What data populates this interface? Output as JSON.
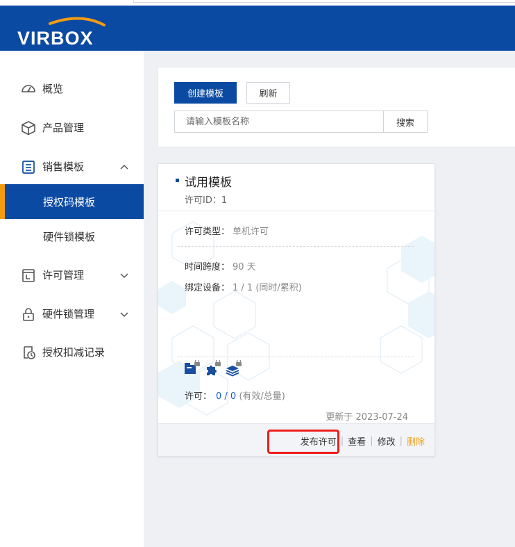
{
  "brand": {
    "logo_text": "VIRBOX",
    "color": "#0b4aa2",
    "accent": "#f39c12"
  },
  "sidebar": {
    "items": [
      {
        "label": "概览",
        "icon": "dashboard-icon"
      },
      {
        "label": "产品管理",
        "icon": "cube-icon"
      },
      {
        "label": "销售模板",
        "icon": "list-icon",
        "expanded": true
      },
      {
        "label": "授权码模板",
        "active": true
      },
      {
        "label": "硬件锁模板"
      },
      {
        "label": "许可管理",
        "icon": "license-icon"
      },
      {
        "label": "硬件锁管理",
        "icon": "lock-icon"
      },
      {
        "label": "授权扣减记录",
        "icon": "history-icon"
      }
    ]
  },
  "toolbar": {
    "create_label": "创建模板",
    "refresh_label": "刷新",
    "search_placeholder": "请输入模板名称",
    "search_label": "搜索"
  },
  "card": {
    "title": "试用模板",
    "license_id": "许可ID：1",
    "license_type_key": "许可类型：",
    "license_type_val": "单机许可",
    "time_span_key": "时间跨度：",
    "time_span_val": "90 天",
    "bind_key": "绑定设备：",
    "bind_val": "1 / 1 (同时/累积)",
    "license_key": "许可：",
    "license_count": "0 / 0",
    "license_hint": "(有效/总量)",
    "updated": "更新于 2023-07-24",
    "actions": {
      "publish": "发布许可",
      "view": "查看",
      "edit": "修改",
      "delete": "删除"
    }
  }
}
